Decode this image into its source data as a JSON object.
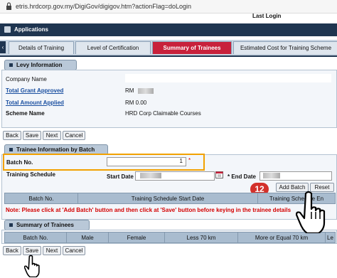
{
  "browser": {
    "url": "etris.hrdcorp.gov.my/DigiGov/digigov.htm?actionFlag=doLogin"
  },
  "header": {
    "last_login_label": "Last Login"
  },
  "app": {
    "title": "Applications"
  },
  "tabs": [
    {
      "label": "Details of Training"
    },
    {
      "label": "Level of Certification"
    },
    {
      "label": "Summary of Trainees"
    },
    {
      "label": "Estimated Cost for Training Scheme"
    }
  ],
  "levy": {
    "section_title": "Levy Information",
    "company_name_label": "Company Name",
    "total_grant_label": "Total Grant Approved",
    "total_grant_value": "RM",
    "total_amount_label": "Total Amount Applied",
    "total_amount_value": "RM 0.00",
    "scheme_name_label": "Scheme Name",
    "scheme_name_value": "HRD Corp Claimable Courses"
  },
  "nav_buttons": {
    "back": "Back",
    "save": "Save",
    "next": "Next",
    "cancel": "Cancel"
  },
  "trainee_batch": {
    "section_title": "Trainee Information by Batch",
    "batch_no_label": "Batch No.",
    "batch_no_value": "1",
    "training_schedule_label": "Training Schedule",
    "start_date_label": "Start Date",
    "end_date_label": "* End Date",
    "required_star": "*",
    "add_batch_label": "Add Batch",
    "reset_label": "Reset",
    "step_badge": "12",
    "columns": [
      "Batch No.",
      "Training Schedule Start Date",
      "Training Schedule En"
    ],
    "note": "Note: Please click at 'Add Batch' button and then click at 'Save' button before keying in the trainee details"
  },
  "summary": {
    "section_title": "Summary of Trainees",
    "columns": [
      "Batch No.",
      "Male",
      "Female",
      "Less 70 km",
      "More or Equal 70 km",
      "Le"
    ]
  },
  "colors": {
    "header_dark": "#1f3550",
    "active_tab": "#c8213b",
    "highlight": "#f2a100",
    "badge": "#d3312b",
    "note_red": "#d40000"
  }
}
